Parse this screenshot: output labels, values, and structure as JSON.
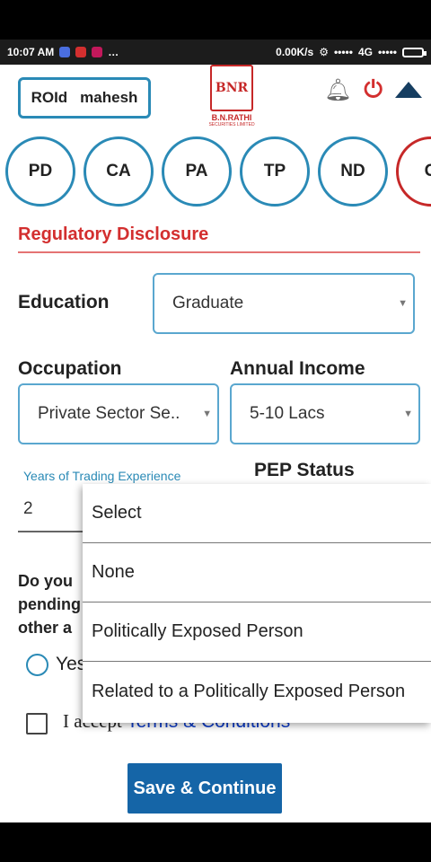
{
  "status_bar": {
    "time": "10:07 AM",
    "speed": "0.00K/s",
    "network": "4G",
    "dots": "•••••"
  },
  "header": {
    "roid_label": "ROId",
    "roid_value": "mahesh",
    "logo_mark": "BNR",
    "logo_name": "B.N.RATHI",
    "logo_sub": "SECURITIES LIMITED"
  },
  "steps": [
    {
      "label": "PD"
    },
    {
      "label": "CA"
    },
    {
      "label": "PA"
    },
    {
      "label": "TP"
    },
    {
      "label": "ND"
    },
    {
      "label": "G"
    }
  ],
  "section_title": "Regulatory Disclosure",
  "form": {
    "education_label": "Education",
    "education_value": "Graduate",
    "occupation_label": "Occupation",
    "occupation_value": "Private Sector Se..",
    "income_label": "Annual Income",
    "income_value": "5-10 Lacs",
    "trading_label": "Years of Trading Experience",
    "trading_value": "2",
    "pep_label": "PEP Status",
    "question_lines": [
      "Do you",
      "pending",
      "other a"
    ],
    "radio_yes": "Yes",
    "accept_prefix": "I accept",
    "accept_terms": "Terms & Conditions",
    "save_label": "Save & Continue"
  },
  "pep_dropdown": {
    "options": [
      "Select",
      "None",
      "Politically Exposed Person",
      "Related to a Politically Exposed Person"
    ]
  },
  "colors": {
    "accent_blue": "#2a8ab6",
    "brand_red": "#c62828",
    "button_blue": "#1565a7",
    "link_blue": "#0d3bc8"
  }
}
